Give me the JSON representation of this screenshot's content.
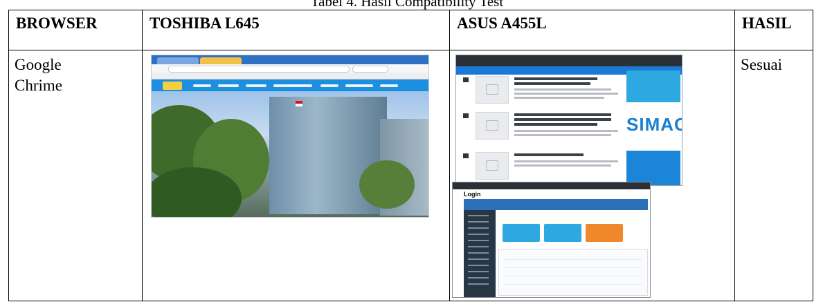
{
  "caption": "Tabel 4. Hasil Compatibility Test",
  "headers": {
    "browser": "BROWSER",
    "device1": "TOSHIBA L645",
    "device2": "ASUS A455L",
    "result": "HASIL"
  },
  "row": {
    "browser": "Google Chrime",
    "result": "Sesuai"
  },
  "screenshots": {
    "toshiba": {
      "description_icon": "web-browser-screenshot"
    },
    "asus": {
      "simacam_text": "SIMACAM",
      "login_title": "Login"
    }
  }
}
